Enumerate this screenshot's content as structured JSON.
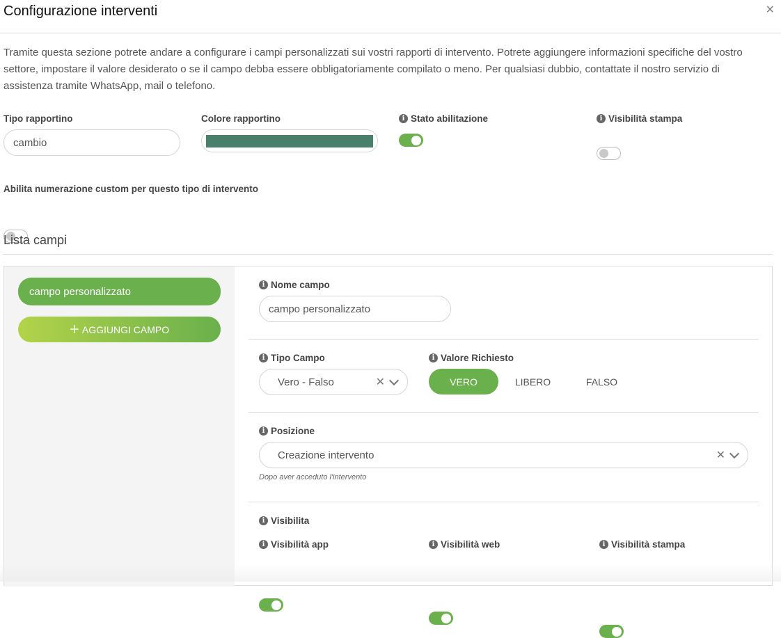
{
  "header": {
    "title": "Configurazione interventi",
    "close_label": "×"
  },
  "description": "Tramite questa sezione potrete andare a configurare i campi personalizzati sui vostri rapporti di intervento. Potrete aggiungere informazioni specifiche del vostro settore, impostare il valore desiderato o se il campo debba essere obbligatoriamente compilato o meno. Per qualsiasi dubbio, contattate il nostro servizio di assistenza tramite WhatsApp, mail o telefono.",
  "form": {
    "tipo_label": "Tipo rapportino",
    "tipo_value": "cambio",
    "colore_label": "Colore rapportino",
    "colore_value": "#4a7f6c",
    "stato_label": "Stato abilitazione",
    "stato_on": true,
    "visibilita_label": "Visibilità stampa",
    "visibilita_on": false,
    "numerazione_label": "Abilita numerazione custom per questo tipo di intervento",
    "numerazione_on": false
  },
  "lista": {
    "title": "Lista campi",
    "fields": [
      "campo personalizzato"
    ],
    "add_label": "AGGIUNGI CAMPO"
  },
  "detail": {
    "nome_label": "Nome campo",
    "nome_value": "campo personalizzato",
    "tipo_label": "Tipo Campo",
    "tipo_value": "Vero - Falso",
    "valore_label": "Valore Richiesto",
    "valore_options": [
      "VERO",
      "LIBERO",
      "FALSO"
    ],
    "valore_selected": "VERO",
    "posizione_label": "Posizione",
    "posizione_value": "Creazione intervento",
    "posizione_hint": "Dopo aver acceduto l'intervento",
    "visibilita_label": "Visibilita",
    "vis_app_label": "Visibilità app",
    "vis_web_label": "Visibilità web",
    "vis_stampa_label": "Visibilità stampa",
    "vis_app_on": true,
    "vis_web_on": true,
    "vis_stampa_on": true
  },
  "icons": {
    "info": "info-icon",
    "close": "close-icon",
    "clear": "clear-icon",
    "chevron": "chevron-down-icon",
    "plus": "plus-icon"
  },
  "colors": {
    "accent": "#6ab04c",
    "accent_light": "#b3d34a"
  }
}
